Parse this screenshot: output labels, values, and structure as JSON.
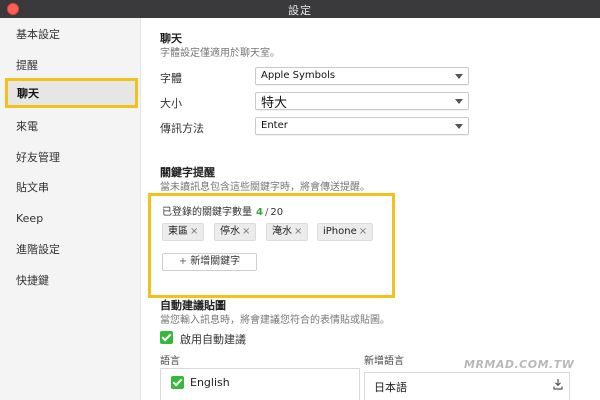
{
  "window": {
    "title": "設定"
  },
  "sidebar": {
    "items": [
      {
        "label": "基本設定"
      },
      {
        "label": "提醒"
      },
      {
        "label": "聊天"
      },
      {
        "label": "來電"
      },
      {
        "label": "好友管理"
      },
      {
        "label": "貼文串"
      },
      {
        "label": "Keep"
      },
      {
        "label": "進階設定"
      },
      {
        "label": "快捷鍵"
      }
    ],
    "active_index": 2
  },
  "chat": {
    "title": "聊天",
    "description": "字體設定僅適用於聊天室。",
    "font": {
      "label": "字體",
      "value": "Apple Symbols"
    },
    "size": {
      "label": "大小",
      "value": "特大"
    },
    "send_method": {
      "label": "傳訊方法",
      "value": "Enter"
    }
  },
  "keywords": {
    "title": "關鍵字提醒",
    "description": "當未讀訊息包含這些關鍵字時，將會傳送提醒。",
    "count_label": "已登錄的關鍵字數量",
    "count": "4",
    "count_separator": "/",
    "limit": "20",
    "items": [
      {
        "label": "東區"
      },
      {
        "label": "停水"
      },
      {
        "label": "淹水"
      },
      {
        "label": "iPhone"
      }
    ],
    "remove_glyph": "×",
    "add_button": "新增關鍵字",
    "add_glyph": "+"
  },
  "auto_suggest": {
    "title": "自動建議貼圖",
    "description": "當您輸入訊息時，將會建議您符合的表情貼或貼圖。",
    "enable_label": "啟用自動建議",
    "language_column": "語言",
    "languages": [
      {
        "label": "English"
      }
    ],
    "new_language_column": "新增語言",
    "new_language_value": "日本語"
  },
  "watermark": {
    "text": "MRMAD.COM.TW"
  },
  "colors": {
    "accent_highlight": "#f3c11b",
    "check_green": "#35b93a",
    "count_green": "#3aa33a"
  }
}
